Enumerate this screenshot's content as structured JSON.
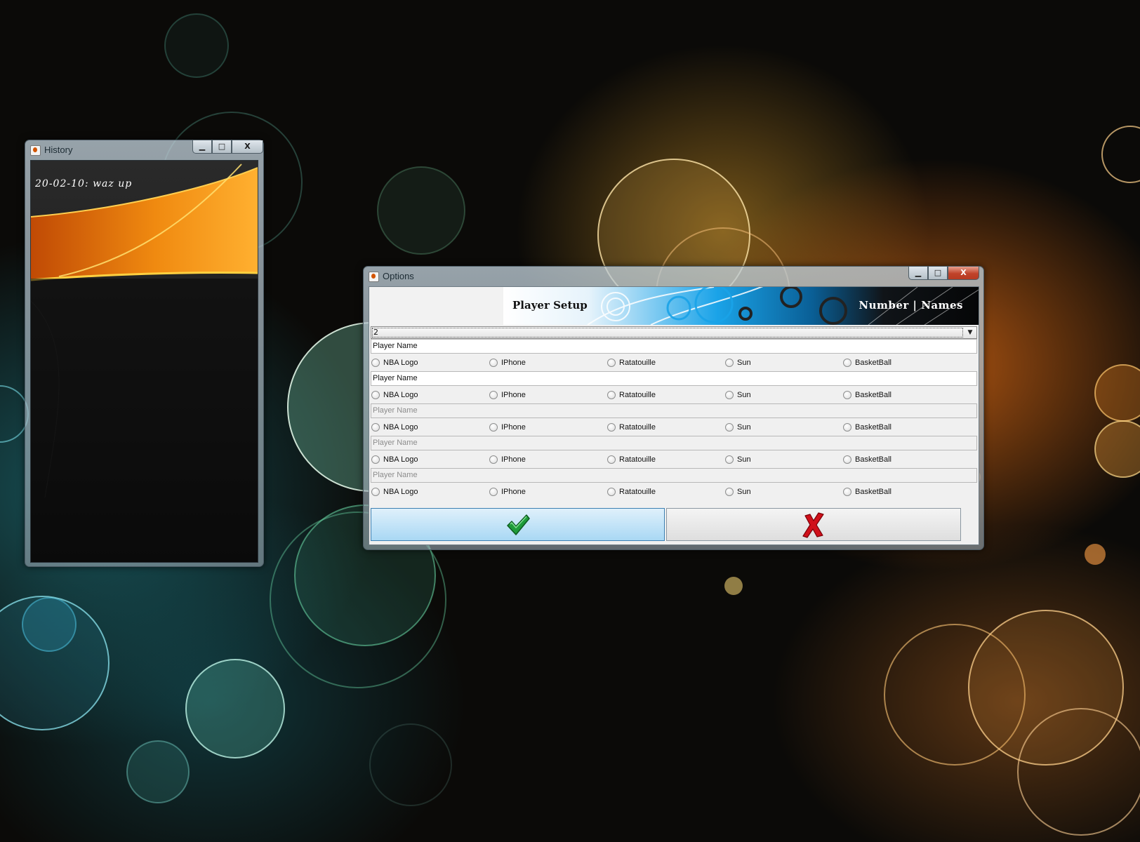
{
  "history_window": {
    "title": "History",
    "entry": "20-02-10: waz up",
    "buttons": {
      "minimize": "▁",
      "maximize": "□",
      "close": "X"
    }
  },
  "options_window": {
    "title": "Options",
    "buttons": {
      "minimize": "▁",
      "maximize": "□",
      "close": "X"
    },
    "banner": {
      "title": "Player Setup",
      "right_label": "Number | Names"
    },
    "player_count": "2",
    "players": [
      {
        "name_placeholder": "Player Name",
        "enabled": true,
        "options": [
          "NBA Logo",
          "IPhone",
          "Ratatouille",
          "Sun",
          "BasketBall"
        ]
      },
      {
        "name_placeholder": "Player Name",
        "enabled": true,
        "options": [
          "NBA Logo",
          "IPhone",
          "Ratatouille",
          "Sun",
          "BasketBall"
        ]
      },
      {
        "name_placeholder": "Player Name",
        "enabled": false,
        "options": [
          "NBA Logo",
          "IPhone",
          "Ratatouille",
          "Sun",
          "BasketBall"
        ]
      },
      {
        "name_placeholder": "Player Name",
        "enabled": false,
        "options": [
          "NBA Logo",
          "IPhone",
          "Ratatouille",
          "Sun",
          "BasketBall"
        ]
      },
      {
        "name_placeholder": "Player Name",
        "enabled": false,
        "options": [
          "NBA Logo",
          "IPhone",
          "Ratatouille",
          "Sun",
          "BasketBall"
        ]
      }
    ],
    "ok_icon": "green-checkmark-icon",
    "cancel_icon": "red-x-icon"
  },
  "colors": {
    "ok_button": "#a9d8f4",
    "checkmark": "#1f9b3a",
    "cancel_x": "#d0101a",
    "banner_accent": "#1aa3e8",
    "history_swoosh": "#f08a10"
  }
}
